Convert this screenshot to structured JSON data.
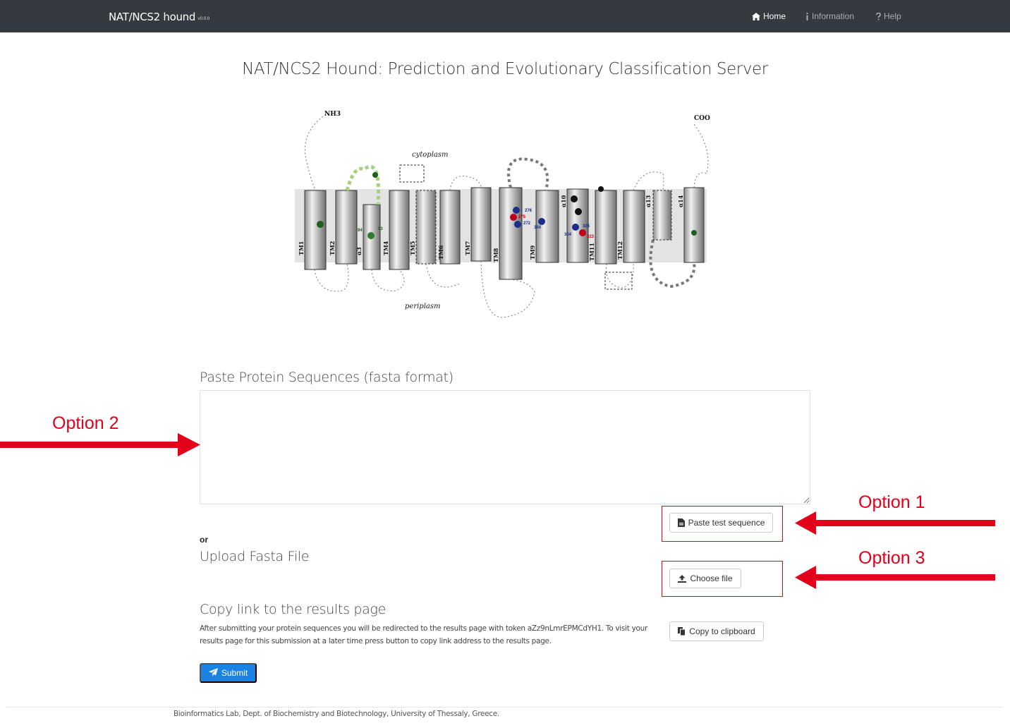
{
  "navbar": {
    "brand": "NAT/NCS2 hound",
    "version": "v0.0.0",
    "items": [
      {
        "label": "Home",
        "icon": "home-icon",
        "active": true
      },
      {
        "label": "Information",
        "icon": "info-icon",
        "active": false
      },
      {
        "label": "Help",
        "icon": "question-icon",
        "active": false
      }
    ]
  },
  "page_title": "NAT/NCS2 Hound: Prediction and Evolutionary Classification Server",
  "diagram": {
    "n_term": "NH3",
    "c_term": "COO",
    "cytoplasm": "cytoplasm",
    "periplasm": "periplasm",
    "segments": [
      "TM1",
      "TM2",
      "α3",
      "TM4",
      "TM5",
      "TM6",
      "TM7",
      "TM8",
      "TM9",
      "α10",
      "TM11",
      "TM12",
      "α13",
      "α14"
    ],
    "residues": [
      "276",
      "275",
      "272",
      "304",
      "94",
      "93",
      "324",
      "325",
      "323"
    ]
  },
  "paste_section": {
    "label": "Paste Protein Sequences (fasta format)",
    "placeholder": "",
    "test_button": "Paste test sequence"
  },
  "or_label": "or",
  "upload_section": {
    "label": "Upload Fasta File",
    "button": "Choose file"
  },
  "copy_section": {
    "label": "Copy link to the results page",
    "description": "After submitting your protein sequences you will be redirected to the results page with token aZz9nLmrEPMCdYH1. To visit your results page for this submission at a later time press button to copy link address to the results page.",
    "button": "Copy to clipboard"
  },
  "submit_label": "Submit",
  "footer": "Bioinformatics Lab, Dept. of Biochemistry and Biotechnology, University of Thessaly, Greece.",
  "annotations": {
    "option1": "Option 1",
    "option2": "Option 2",
    "option3": "Option 3"
  },
  "colors": {
    "navbar_bg": "#343a40",
    "accent": "#1a82e2",
    "annotation_red": "#e3001b"
  }
}
